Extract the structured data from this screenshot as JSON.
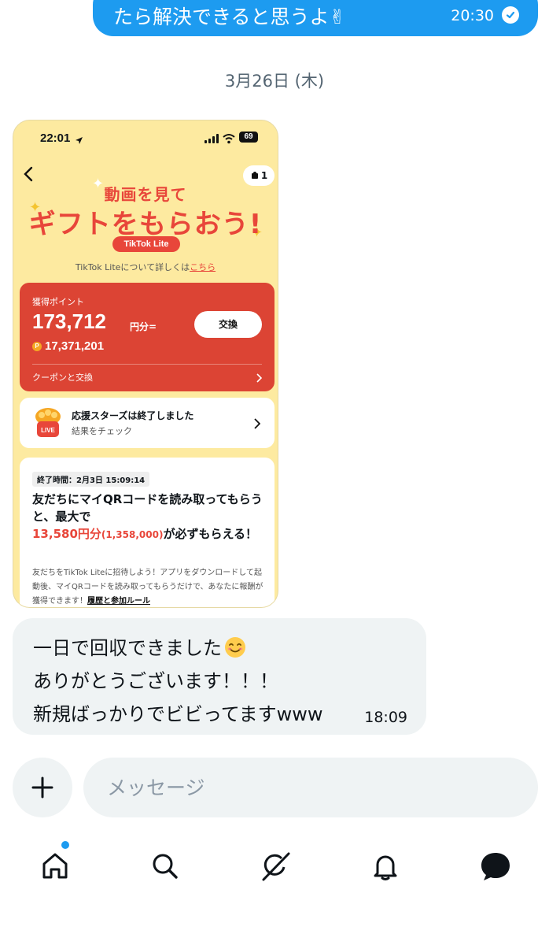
{
  "outgoing": {
    "text": "たら解決できると思うよ✌",
    "time": "20:30"
  },
  "date_separator": "3月26日 (木)",
  "attachment": {
    "status_time": "22:01",
    "battery": "69",
    "badge_count": "1",
    "hero_line1": "動画を見て",
    "hero_line2": "ギフトをもらおう!",
    "logo_text": "TikTok Lite",
    "info_prefix": "TikTok Liteについて詳しくは",
    "info_link": "こちら",
    "points_label": "獲得ポイント",
    "points_value": "173,712",
    "points_unit": "円分=",
    "points_coins": "17,371,201",
    "exchange_button": "交換",
    "coupon_link": "クーポンと交換",
    "live_title": "応援スターズは終了しました",
    "live_subtitle": "結果をチェック",
    "live_badge": "LIVE",
    "campaign_tag": "終了時間：2月3日 15:09:14",
    "campaign_title_a": "友だちにマイQRコードを読み取ってもらうと、最大で",
    "campaign_amount": "13,580円分",
    "campaign_coins": "(1,358,000)",
    "campaign_title_b": "が必ずもらえる！",
    "campaign_desc": "友だちをTikTok Liteに招待しよう！アプリをダウンロードして起動後、マイQRコードを読み取ってもらうだけで、あなたに報酬が獲得できます！",
    "campaign_rules_link": "履歴と参加ルール"
  },
  "incoming": {
    "line1": "一日で回収できました",
    "line2": "ありがとうございます！！！",
    "line3": "新規ばっかりでビビってますwww",
    "time": "18:09"
  },
  "composer": {
    "placeholder": "メッセージ"
  },
  "nav": {
    "items": [
      "home-icon",
      "search-icon",
      "grok-icon",
      "bell-icon",
      "messages-icon"
    ]
  },
  "colors": {
    "accent": "#1d9bf0",
    "bubble_gray": "#eff3f4",
    "tiktok_red": "#dc4434",
    "tiktok_yellow": "#fdeaa0"
  }
}
